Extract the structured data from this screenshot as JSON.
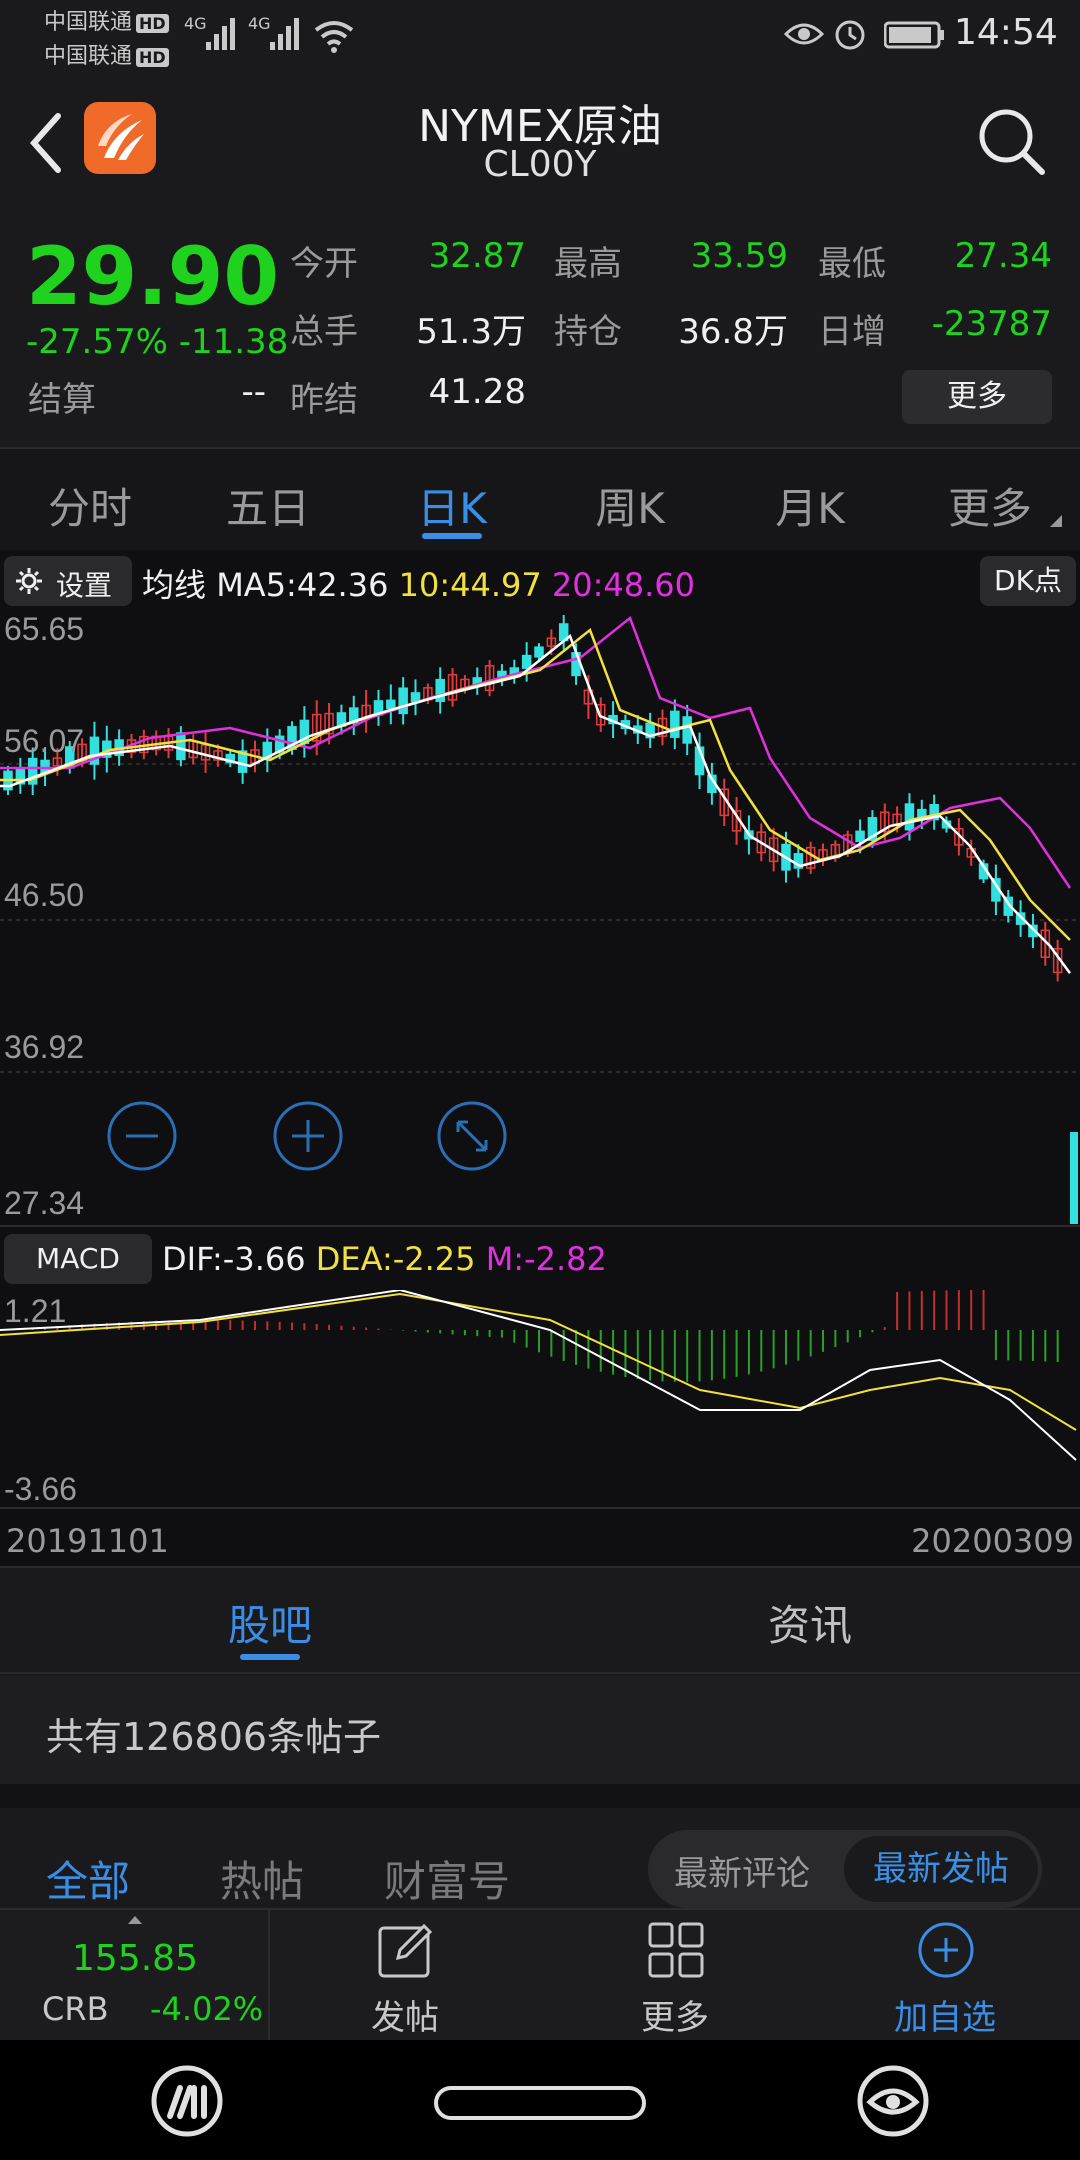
{
  "status": {
    "carrier1": "中国联通",
    "carrier2": "中国联通",
    "hd": "HD",
    "network1": "4G",
    "network2": "4G",
    "time": "14:54"
  },
  "header": {
    "title": "NYMEX原油",
    "subtitle": "CL00Y"
  },
  "quote": {
    "price": "29.90",
    "change": "-27.57% -11.38",
    "settle_label": "结算",
    "settle_value": "--",
    "open_label": "今开",
    "open_value": "32.87",
    "high_label": "最高",
    "high_value": "33.59",
    "low_label": "最低",
    "low_value": "27.34",
    "volume_label": "总手",
    "volume_value": "51.3万",
    "position_label": "持仓",
    "position_value": "36.8万",
    "daily_inc_label": "日增",
    "daily_inc_value": "-23787",
    "prev_settle_label": "昨结",
    "prev_settle_value": "41.28",
    "more_button": "更多"
  },
  "tabs": [
    "分时",
    "五日",
    "日K",
    "周K",
    "月K",
    "更多"
  ],
  "active_tab": "日K",
  "chart_toolbar": {
    "settings_label": "设置",
    "ma_label": "均线",
    "ma5": "MA5:42.36",
    "ma10": "10:44.97",
    "ma20": "20:48.60",
    "dk_button": "DK点"
  },
  "price_axis": [
    "65.65",
    "56.07",
    "46.50",
    "36.92",
    "27.34"
  ],
  "macd": {
    "label": "MACD",
    "dif": "DIF:-3.66",
    "dea": "DEA:-2.25",
    "m": "M:-2.82",
    "axis_top": "1.21",
    "axis_bottom": "-3.66"
  },
  "date_range": {
    "start": "20191101",
    "end": "20200309"
  },
  "community": {
    "tab_guba": "股吧",
    "tab_news": "资讯",
    "post_count": "共有126806条帖子",
    "filter_all": "全部",
    "filter_hot": "热帖",
    "filter_wealth": "财富号",
    "sort_latest_comment": "最新评论",
    "sort_latest_post": "最新发帖"
  },
  "bottom_nav": {
    "index_value": "155.85",
    "index_name": "CRB",
    "index_change": "-4.02%",
    "post_label": "发帖",
    "more_label": "更多",
    "add_label": "加自选"
  },
  "colors": {
    "up": "#e03c3c",
    "down": "#1ed21e",
    "candle_down": "#33e0e0",
    "ma5": "#ffffff",
    "ma10": "#f0e040",
    "ma20": "#e030e0",
    "accent": "#3a8ee6",
    "macd_bar_up": "#c03030",
    "macd_bar_down": "#2aa02a"
  }
}
